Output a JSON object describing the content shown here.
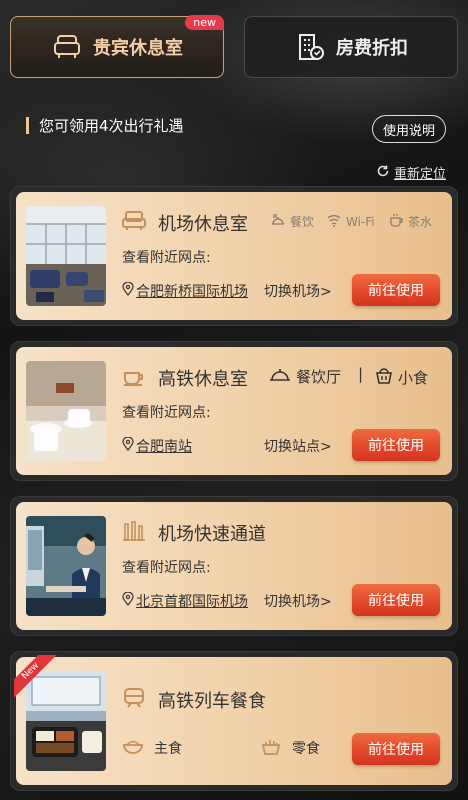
{
  "tabs": {
    "vip_lounge": {
      "label": "贵宾休息室",
      "badge": "new",
      "icon": "sofa-icon"
    },
    "room_discount": {
      "label": "房费折扣",
      "icon": "hotel-building-icon"
    }
  },
  "perks": {
    "text": "您可领用4次出行礼遇"
  },
  "guide_button": {
    "label": "使用说明"
  },
  "relocate": {
    "label": "重新定位",
    "icon": "refresh-icon"
  },
  "cards": [
    {
      "title": "机场休息室",
      "icon": "sofa-icon",
      "amenities": [
        {
          "icon": "food-icon",
          "label": "餐饮"
        },
        {
          "icon": "wifi-icon",
          "label": "Wi-Fi"
        },
        {
          "icon": "tea-icon",
          "label": "茶水"
        }
      ],
      "nearby_label": "查看附近网点:",
      "location": "合肥新桥国际机场",
      "switch_label": "切换机场>",
      "go_label": "前往使用"
    },
    {
      "title": "高铁休息室",
      "icon": "cup-icon",
      "amenities": [
        {
          "icon": "cloche-icon",
          "label": "餐饮厅"
        },
        {
          "icon": "snack-icon",
          "label": "小食"
        }
      ],
      "nearby_label": "查看附近网点:",
      "location": "合肥南站",
      "switch_label": "切换站点>",
      "go_label": "前往使用"
    },
    {
      "title": "机场快速通道",
      "icon": "fast-lane-icon",
      "nearby_label": "查看附近网点:",
      "location": "北京首都国际机场",
      "switch_label": "切换机场>",
      "go_label": "前往使用"
    },
    {
      "title": "高铁列车餐食",
      "icon": "train-icon",
      "ribbon": "New",
      "foods": [
        {
          "icon": "rice-bowl-icon",
          "label": "主食"
        },
        {
          "icon": "snack-basket-icon",
          "label": "零食"
        }
      ],
      "go_label": "前往使用"
    }
  ],
  "colors": {
    "accent_gold": "#c9a27a",
    "button_red": "#d6321f",
    "card_gold": "#f2d4ae",
    "badge_red": "#e63a4a"
  }
}
